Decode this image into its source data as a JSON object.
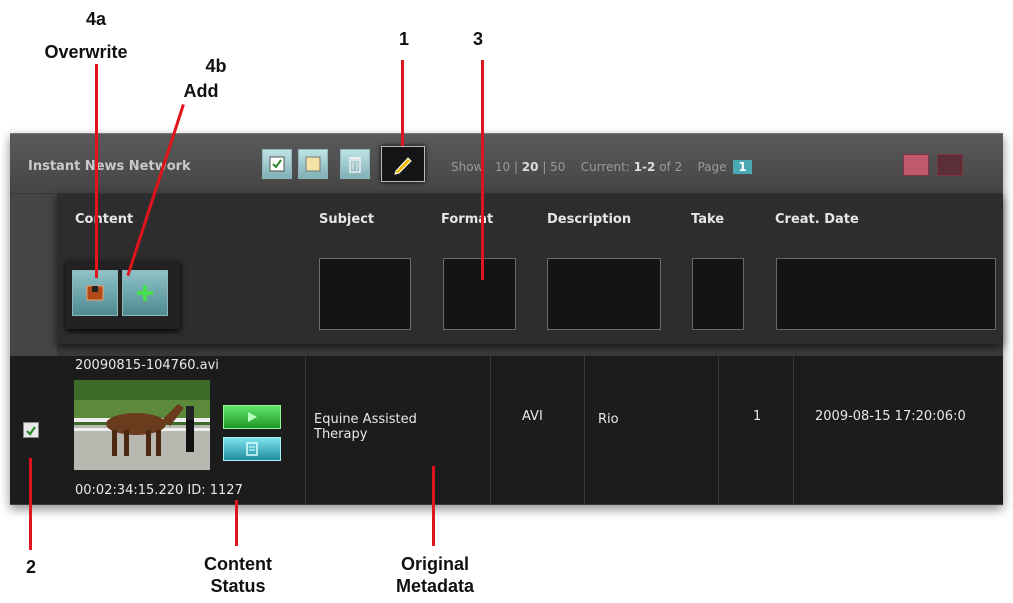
{
  "callouts": {
    "c4a_num": "4a",
    "c4a_text": "Overwrite",
    "c4b_num": "4b",
    "c4b_text": "Add",
    "c1": "1",
    "c3": "3",
    "c2": "2",
    "content_status_1": "Content",
    "content_status_2": "Status",
    "original_metadata_1": "Original",
    "original_metadata_2": "Metadata"
  },
  "toolbar": {
    "brand": "Instant News Network",
    "buttons": [
      "select-all",
      "deselect",
      "delete",
      "edit-metadata"
    ],
    "show_label": "Show",
    "page_sizes": [
      "10",
      "20",
      "50"
    ],
    "page_size_selected": "20",
    "current_label": "Current:",
    "current_range": "1-2",
    "current_of": "of 2",
    "page_label": "Page",
    "page_value": "1"
  },
  "columns": {
    "content": "Content",
    "subject": "Subject",
    "format": "Format",
    "description": "Description",
    "take": "Take",
    "created": "Creat. Date"
  },
  "actions": {
    "overwrite": "overwrite-button",
    "add": "add-button"
  },
  "row": {
    "checked": true,
    "filename": "20090815-104760.avi",
    "timecode": "00:02:34:15.220",
    "id_label": "ID: 1127",
    "subject_1": "Equine Assisted",
    "subject_2": "Therapy",
    "format": "AVI",
    "description": "Rio",
    "take": "1",
    "created": "2009-08-15 17:20:06:0"
  },
  "colors": {
    "accent": "#4aa9b3",
    "callout_line": "#e0141c",
    "row_bg": "#1c1c1c"
  }
}
